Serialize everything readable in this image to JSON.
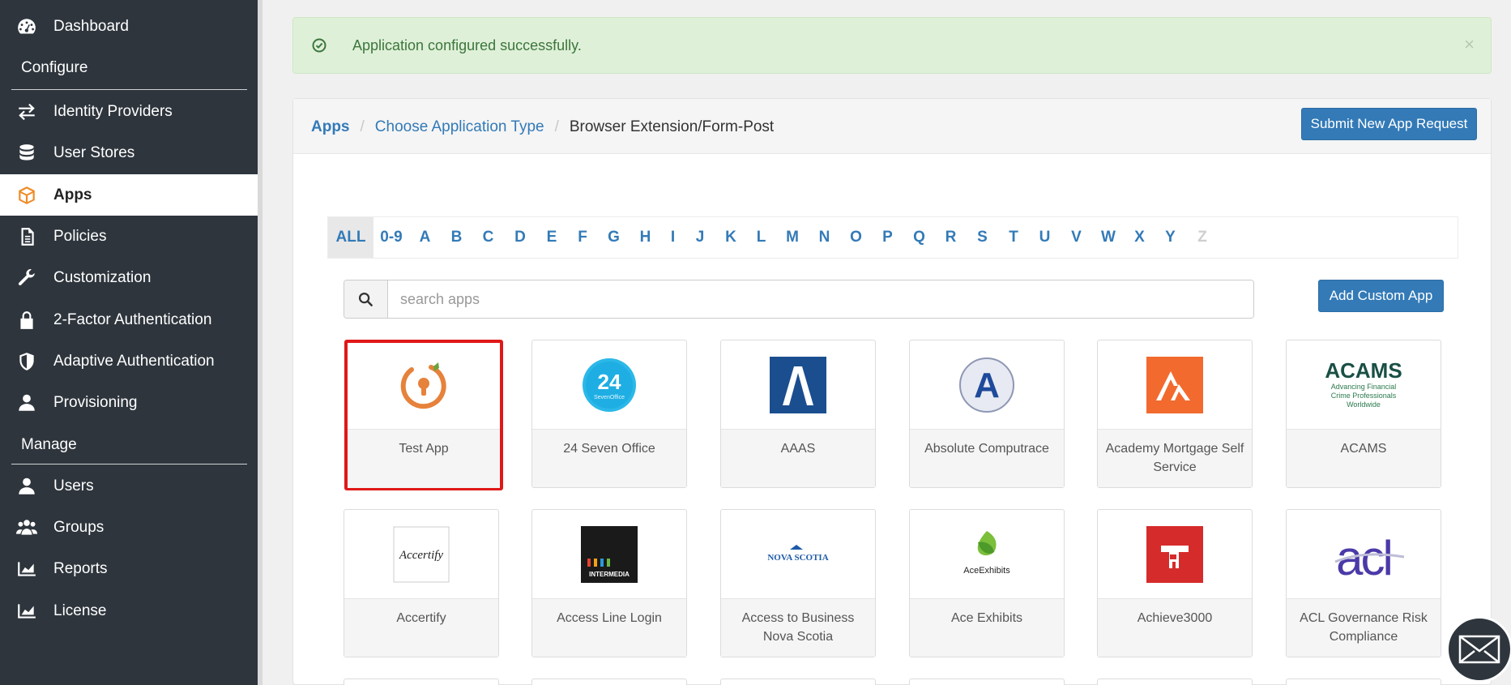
{
  "sidebar": {
    "items": [
      {
        "label": "Dashboard",
        "icon": "dashboard-icon"
      },
      {
        "label": "Identity Providers",
        "icon": "exchange-icon"
      },
      {
        "label": "User Stores",
        "icon": "database-icon"
      },
      {
        "label": "Apps",
        "icon": "cube-icon",
        "active": true
      },
      {
        "label": "Policies",
        "icon": "document-icon"
      },
      {
        "label": "Customization",
        "icon": "wrench-icon"
      },
      {
        "label": "2-Factor Authentication",
        "icon": "lock-icon"
      },
      {
        "label": "Adaptive Authentication",
        "icon": "shield-icon"
      },
      {
        "label": "Provisioning",
        "icon": "user-icon"
      },
      {
        "label": "Users",
        "icon": "user-icon"
      },
      {
        "label": "Groups",
        "icon": "users-icon"
      },
      {
        "label": "Reports",
        "icon": "area-chart-icon"
      },
      {
        "label": "License",
        "icon": "area-chart-icon"
      }
    ],
    "sections": {
      "configure": "Configure",
      "manage": "Manage"
    }
  },
  "alert": {
    "message": "Application configured successfully.",
    "close": "×",
    "icon": "check-circle-icon"
  },
  "breadcrumb": {
    "apps": "Apps",
    "choose": "Choose Application Type",
    "current": "Browser Extension/Form-Post",
    "sep": "/"
  },
  "buttons": {
    "submit_request": "Submit New App Request",
    "add_custom": "Add Custom App"
  },
  "alphabet": {
    "all": "ALL",
    "letters": [
      "0-9",
      "A",
      "B",
      "C",
      "D",
      "E",
      "F",
      "G",
      "H",
      "I",
      "J",
      "K",
      "L",
      "M",
      "N",
      "O",
      "P",
      "Q",
      "R",
      "S",
      "T",
      "U",
      "V",
      "W",
      "X",
      "Y",
      "Z"
    ],
    "disabled": [
      "Z"
    ]
  },
  "search": {
    "placeholder": "search apps"
  },
  "apps": [
    {
      "name": "Test App",
      "selected": true
    },
    {
      "name": "24 Seven Office",
      "logo_text": "24"
    },
    {
      "name": "AAAS"
    },
    {
      "name": "Absolute Computrace",
      "logo_text": "A"
    },
    {
      "name": "Academy Mortgage Self Service"
    },
    {
      "name": "ACAMS",
      "logo_text": "ACAMS",
      "logo_sub": "Advancing Financial Crime Professionals Worldwide"
    },
    {
      "name": "Accertify",
      "logo_text": "Accertify"
    },
    {
      "name": "Access Line Login",
      "logo_text": "INTERMEDIA"
    },
    {
      "name": "Access to Business Nova Scotia",
      "logo_text": "NOVA SCOTIA"
    },
    {
      "name": "Ace Exhibits",
      "logo_text": "AceExhibits"
    },
    {
      "name": "Achieve3000"
    },
    {
      "name": "ACL Governance Risk Compliance",
      "logo_text": "acl"
    }
  ],
  "colors": {
    "sidebar_bg": "#2e353d",
    "accent": "#337ab7",
    "active_icon": "#f08a24",
    "selected_border": "#e01818",
    "alert_bg": "#dff0d8"
  }
}
